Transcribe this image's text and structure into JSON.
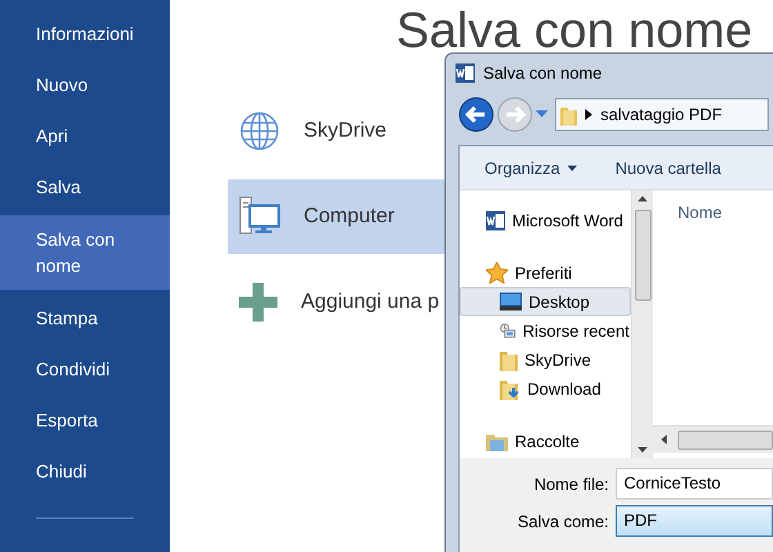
{
  "sidebar": {
    "items": [
      {
        "label": "Informazioni",
        "selected": false
      },
      {
        "label": "Nuovo",
        "selected": false
      },
      {
        "label": "Apri",
        "selected": false
      },
      {
        "label": "Salva",
        "selected": false
      },
      {
        "label": "Salva con nome",
        "selected": true
      },
      {
        "label": "Stampa",
        "selected": false
      },
      {
        "label": "Condividi",
        "selected": false
      },
      {
        "label": "Esporta",
        "selected": false
      },
      {
        "label": "Chiudi",
        "selected": false
      }
    ]
  },
  "title": "Salva con nome",
  "places": [
    {
      "kind": "globe",
      "label": "SkyDrive",
      "selected": false
    },
    {
      "kind": "computer",
      "label": "Computer",
      "selected": true
    },
    {
      "kind": "plus",
      "label": "Aggiungi una p",
      "selected": false
    }
  ],
  "dialog": {
    "title": "Salva con nome",
    "address": "salvataggio PDF",
    "toolbar": [
      {
        "label": "Organizza",
        "dropdown": true
      },
      {
        "label": "Nuova cartella",
        "dropdown": false
      }
    ],
    "tree": [
      {
        "kind": "word",
        "label": "Microsoft Word",
        "selected": false
      },
      {
        "kind": "star",
        "label": "Preferiti",
        "selected": false,
        "children": [
          {
            "kind": "desktop",
            "label": "Desktop",
            "selected": true
          },
          {
            "kind": "recent",
            "label": "Risorse recent",
            "selected": false
          },
          {
            "kind": "folder",
            "label": "SkyDrive",
            "selected": false
          },
          {
            "kind": "download",
            "label": "Download",
            "selected": false
          }
        ]
      },
      {
        "kind": "library",
        "label": "Raccolte",
        "selected": false
      }
    ],
    "column_header": "Nome",
    "fields": [
      {
        "kind": "text",
        "label": "Nome file:",
        "value": "CorniceTesto"
      },
      {
        "kind": "select",
        "label": "Salva come:",
        "value": "PDF"
      }
    ]
  }
}
